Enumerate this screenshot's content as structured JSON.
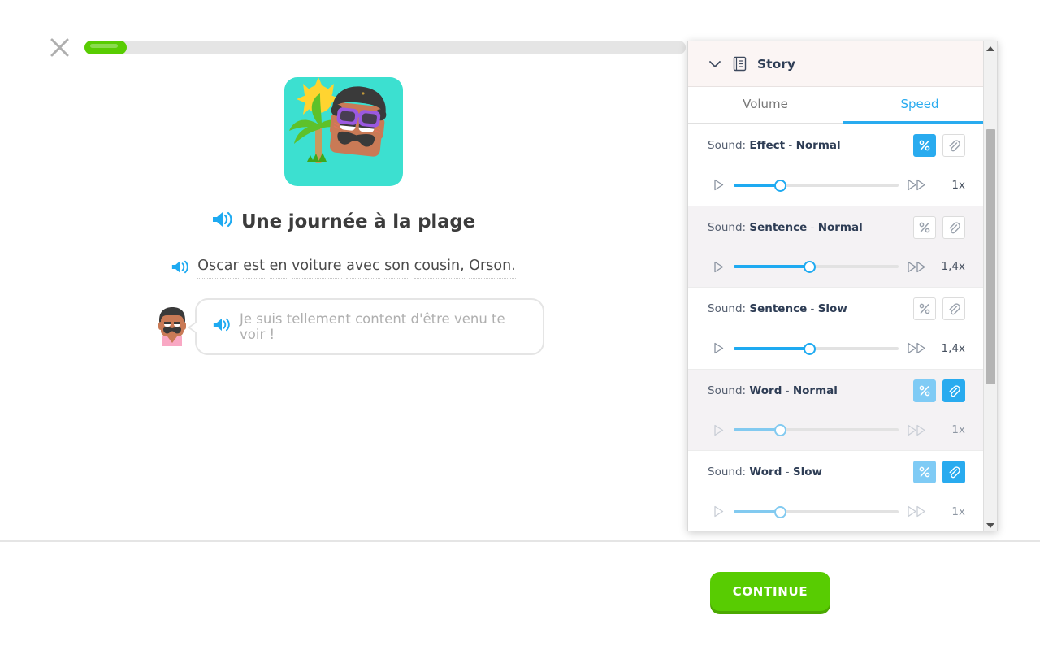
{
  "topbar": {
    "close_icon": "close-icon",
    "progress_percent": 7
  },
  "story": {
    "illustration_alt": "beach-scene-illustration",
    "title": "Une journée à la plage",
    "title_speaker_icon": "speaker-icon",
    "narration": {
      "speaker_icon": "speaker-icon",
      "words": [
        "Oscar",
        "est",
        "en",
        "voiture",
        "avec",
        "son",
        "cousin,",
        "Orson."
      ]
    },
    "bubble": {
      "avatar_icon": "character-avatar",
      "speaker_icon": "speaker-icon",
      "text": "Je suis tellement content d'être venu te voir !"
    }
  },
  "footer": {
    "continue_label": "CONTINUE"
  },
  "panel": {
    "header": {
      "collapse_icon": "chevron-down-icon",
      "doc_icon": "document-icon",
      "title": "Story"
    },
    "tabs": [
      {
        "label": "Volume",
        "active": false
      },
      {
        "label": "Speed",
        "active": true
      }
    ],
    "rows": [
      {
        "prefix": "Sound:",
        "kind": "Effect",
        "sep": "-",
        "variant": "Normal",
        "percent_button": {
          "icon": "percent-icon",
          "state": "on"
        },
        "clip_button": {
          "icon": "paperclip-icon",
          "state": "off"
        },
        "play_icon": "play-icon",
        "forward_icon": "fast-forward-icon",
        "slider_percent": 28,
        "rate": "1x",
        "disabled": false,
        "shaded": false
      },
      {
        "prefix": "Sound:",
        "kind": "Sentence",
        "sep": "-",
        "variant": "Normal",
        "percent_button": {
          "icon": "percent-icon",
          "state": "off"
        },
        "clip_button": {
          "icon": "paperclip-icon",
          "state": "off"
        },
        "play_icon": "play-icon",
        "forward_icon": "fast-forward-icon",
        "slider_percent": 46,
        "rate": "1,4x",
        "disabled": false,
        "shaded": true
      },
      {
        "prefix": "Sound:",
        "kind": "Sentence",
        "sep": "-",
        "variant": "Slow",
        "percent_button": {
          "icon": "percent-icon",
          "state": "off"
        },
        "clip_button": {
          "icon": "paperclip-icon",
          "state": "off"
        },
        "play_icon": "play-icon",
        "forward_icon": "fast-forward-icon",
        "slider_percent": 46,
        "rate": "1,4x",
        "disabled": false,
        "shaded": false
      },
      {
        "prefix": "Sound:",
        "kind": "Word",
        "sep": "-",
        "variant": "Normal",
        "percent_button": {
          "icon": "percent-icon",
          "state": "dim"
        },
        "clip_button": {
          "icon": "paperclip-icon",
          "state": "on"
        },
        "play_icon": "play-icon",
        "forward_icon": "fast-forward-icon",
        "slider_percent": 28,
        "rate": "1x",
        "disabled": true,
        "shaded": true
      },
      {
        "prefix": "Sound:",
        "kind": "Word",
        "sep": "-",
        "variant": "Slow",
        "percent_button": {
          "icon": "percent-icon",
          "state": "dim"
        },
        "clip_button": {
          "icon": "paperclip-icon",
          "state": "on"
        },
        "play_icon": "play-icon",
        "forward_icon": "fast-forward-icon",
        "slider_percent": 28,
        "rate": "1x",
        "disabled": true,
        "shaded": false
      }
    ],
    "scrollbar": {
      "up_icon": "scroll-up-arrow-icon",
      "down_icon": "scroll-down-arrow-icon",
      "thumb_top_percent": 16,
      "thumb_height_percent": 55
    }
  },
  "colors": {
    "brand_green": "#58cc02",
    "brand_green_dark": "#4ba901",
    "accent_blue": "#1eaaf1",
    "accent_blue_dim": "#82caf0",
    "text_dark": "#3c3c3c",
    "text_muted": "#afafaf"
  }
}
